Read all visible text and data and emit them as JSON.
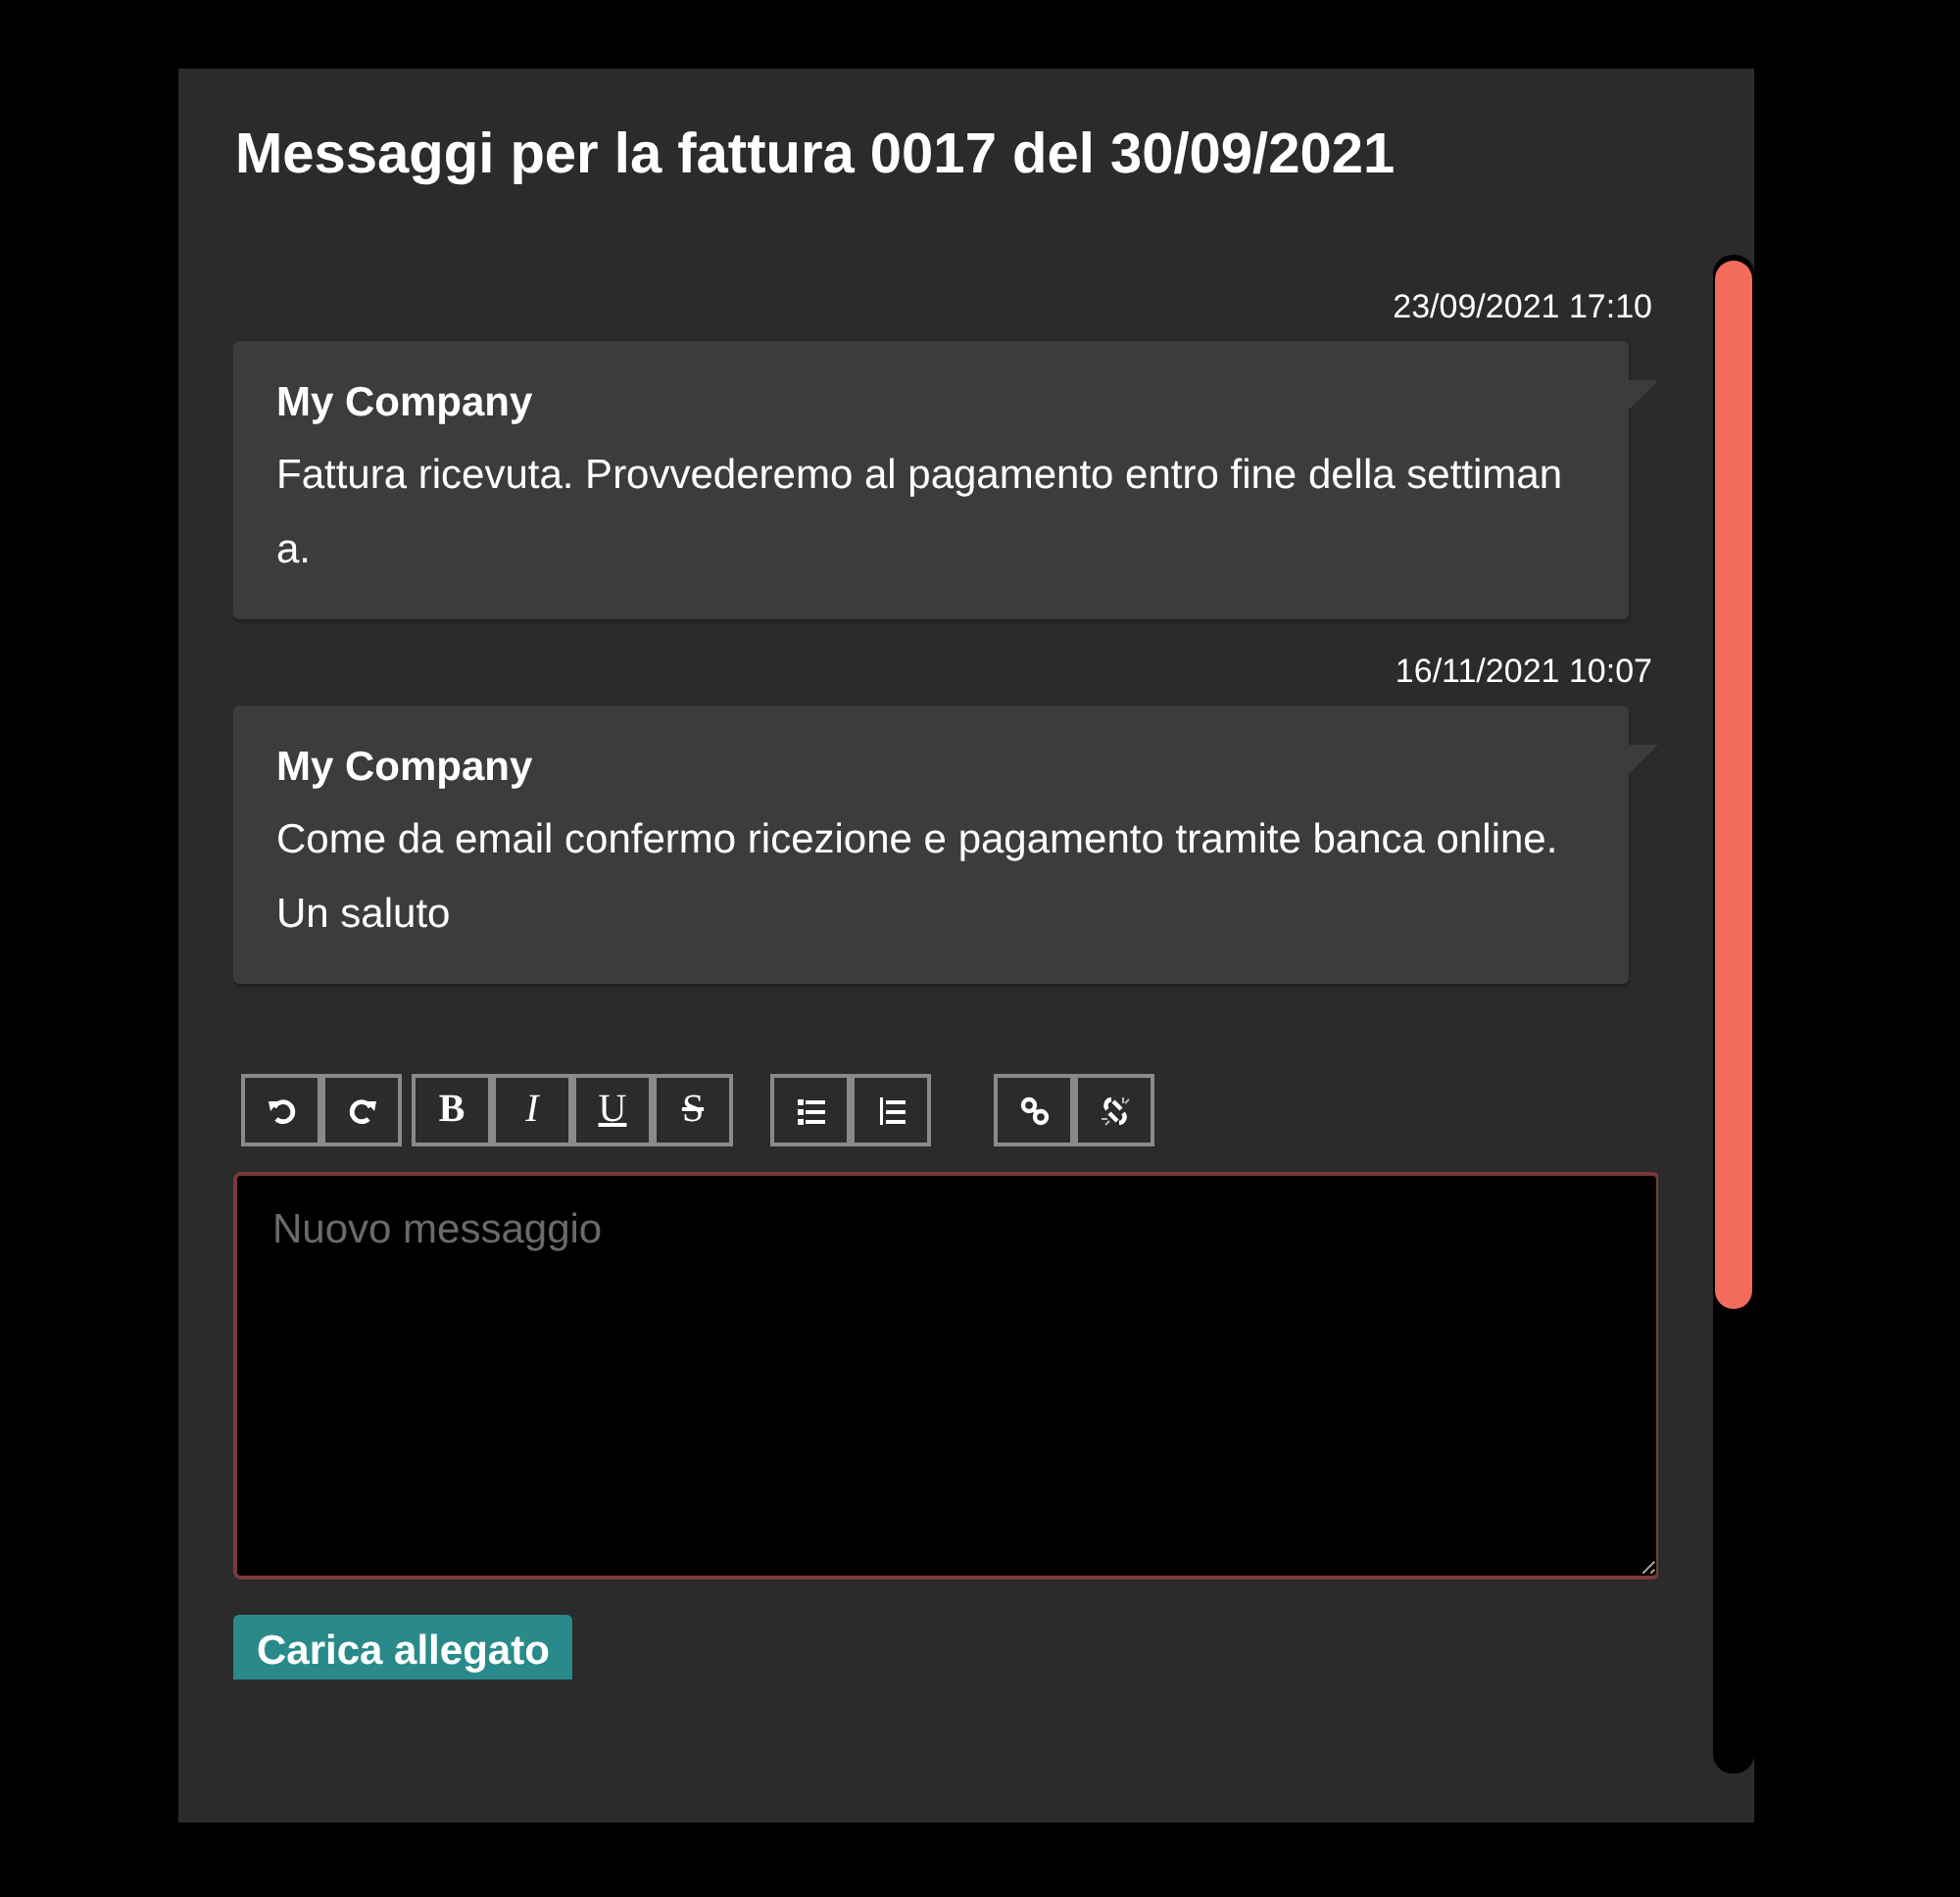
{
  "dialog": {
    "title": "Messaggi per la fattura 0017 del 30/09/2021"
  },
  "messages": [
    {
      "timestamp": "23/09/2021 17:10",
      "sender": "My Company",
      "text": "Fattura ricevuta. Provvederemo al pagamento entro fine della settimana."
    },
    {
      "timestamp": "16/11/2021 10:07",
      "sender": "My Company",
      "text": "Come da email confermo ricezione e pagamento tramite banca online. Un saluto"
    }
  ],
  "toolbar": {
    "groups": [
      [
        {
          "kind": "undo"
        },
        {
          "kind": "redo"
        }
      ],
      [
        {
          "kind": "bold",
          "label": "B"
        },
        {
          "kind": "italic",
          "label": "I"
        },
        {
          "kind": "underline",
          "label": "U"
        },
        {
          "kind": "strikethrough",
          "label": "S"
        }
      ],
      [
        {
          "kind": "bullets"
        },
        {
          "kind": "numbering"
        }
      ],
      [
        {
          "kind": "link"
        },
        {
          "kind": "unlink"
        }
      ]
    ]
  },
  "editor": {
    "placeholder": "Nuovo messaggio"
  },
  "upload_button": {
    "label": "Carica allegato"
  }
}
